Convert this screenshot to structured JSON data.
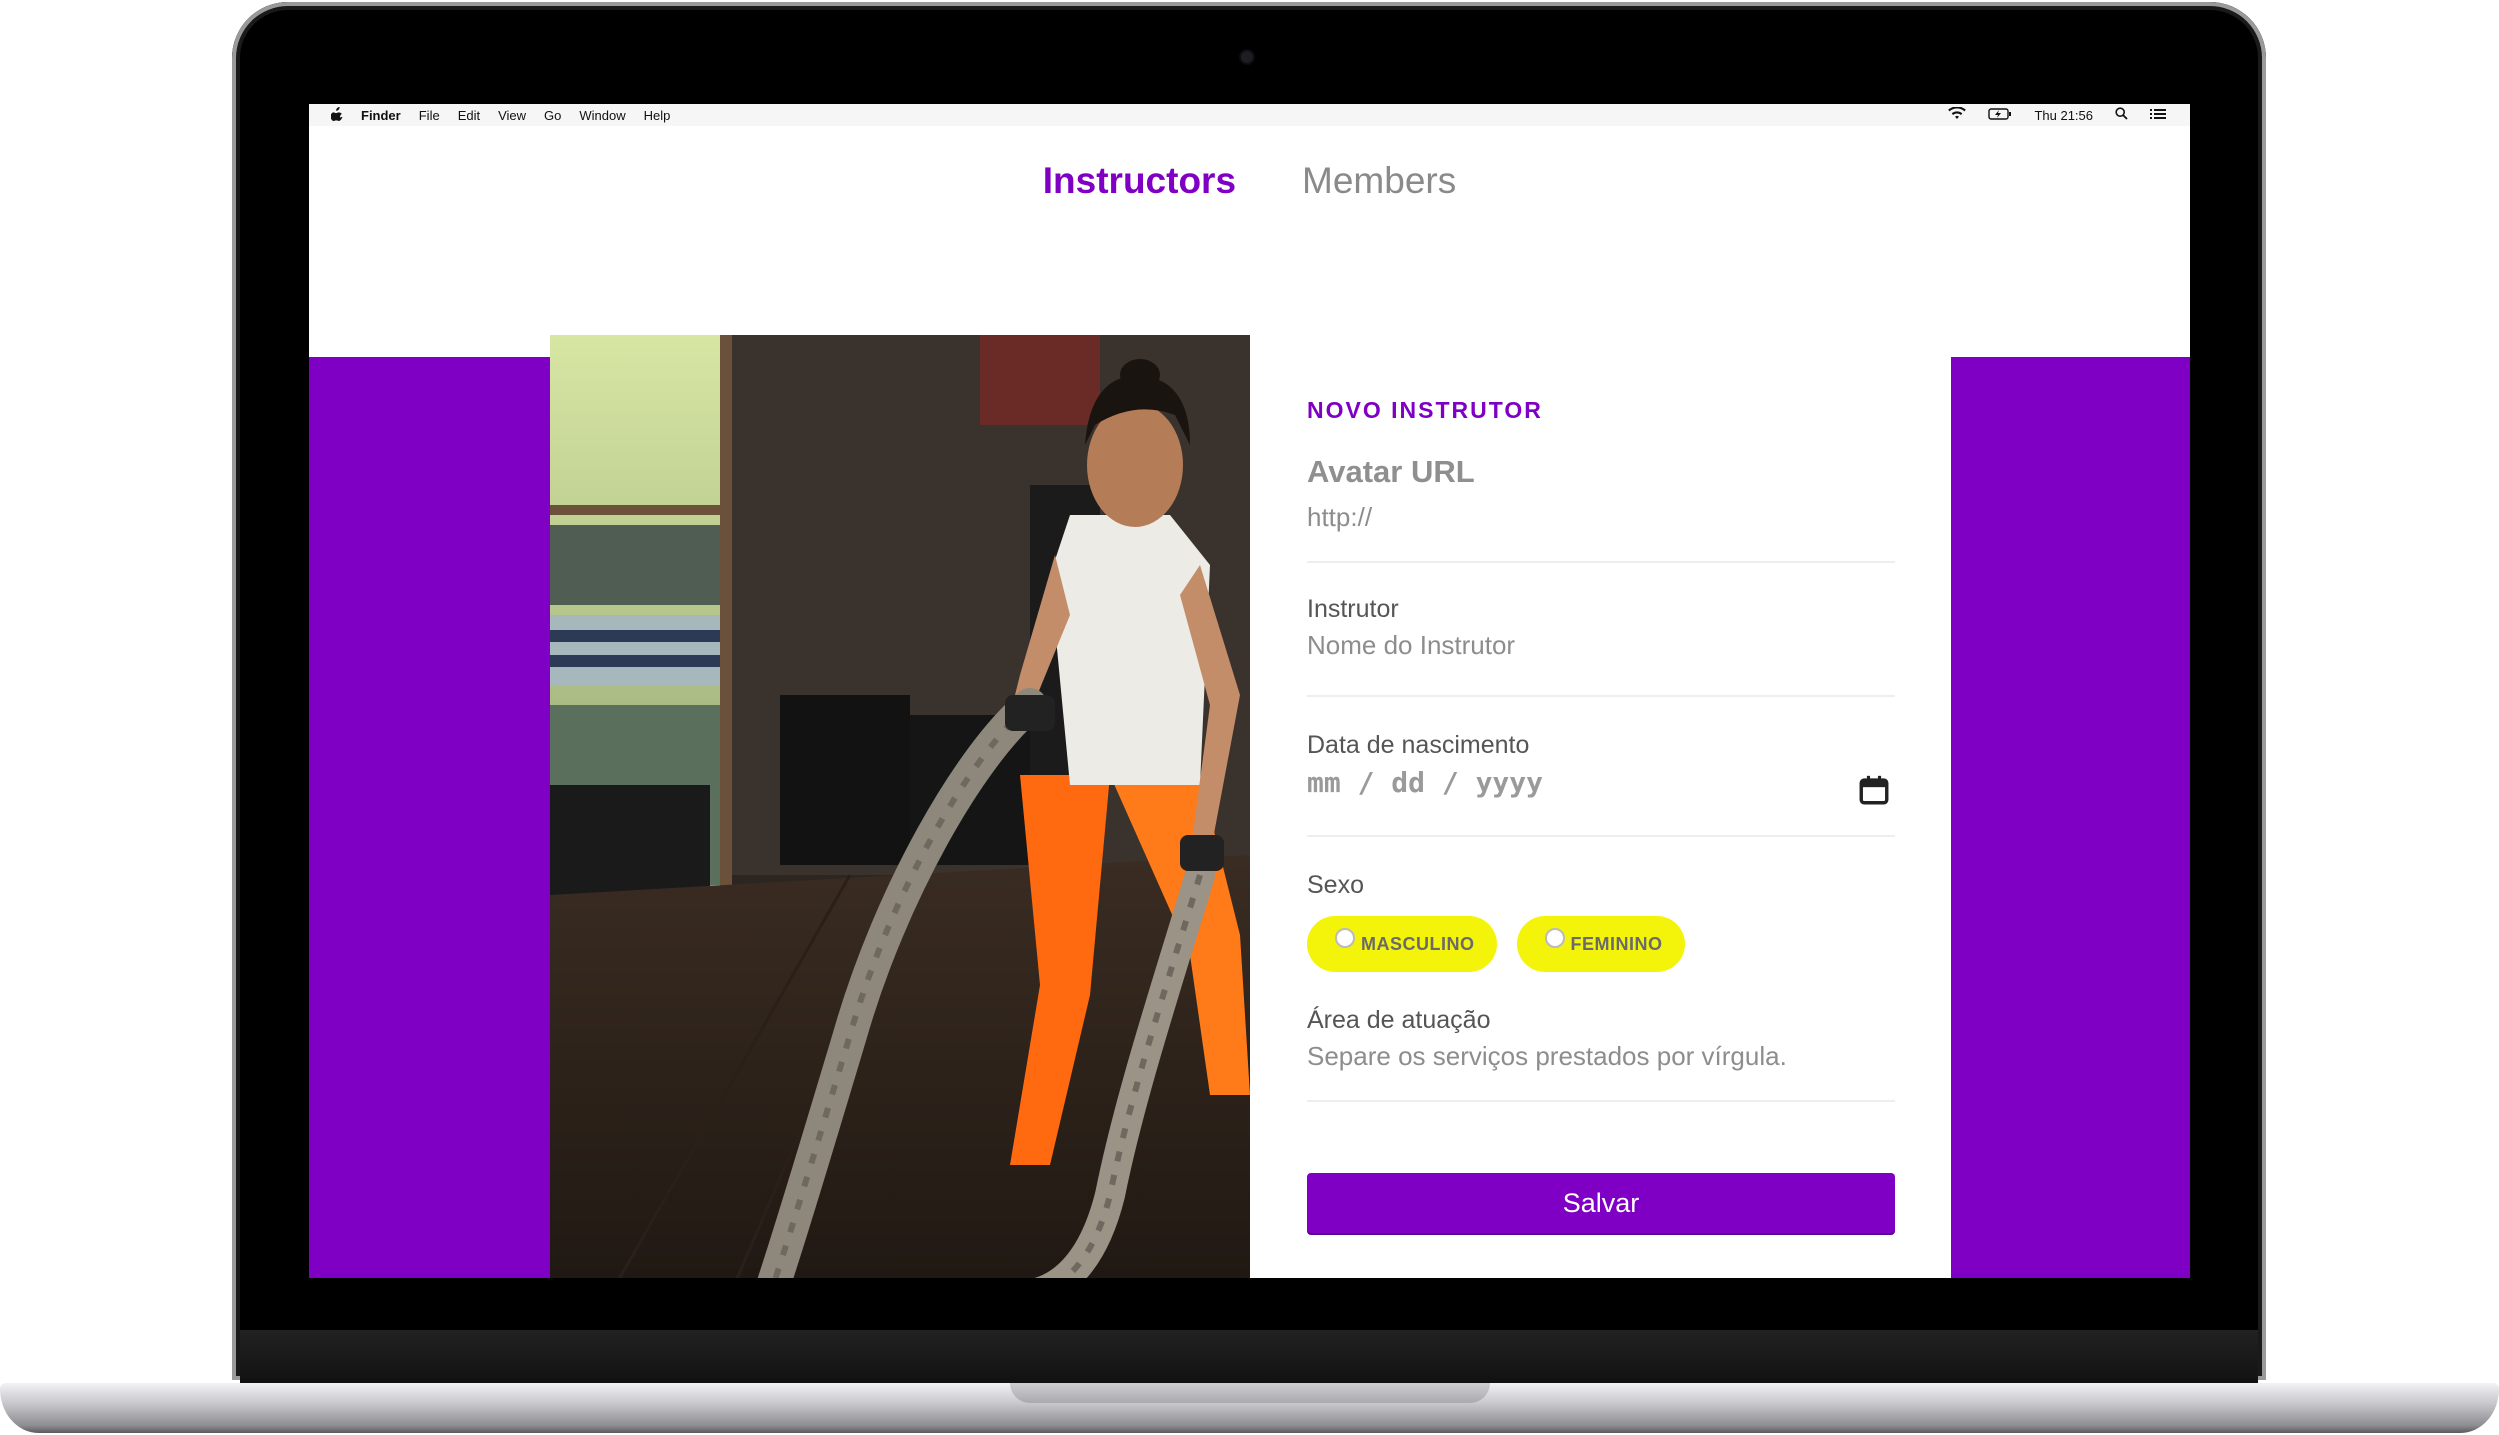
{
  "macos_menubar": {
    "app_name": "Finder",
    "menus": [
      "File",
      "Edit",
      "View",
      "Go",
      "Window",
      "Help"
    ],
    "clock": "Thu 21:56"
  },
  "header": {
    "nav": {
      "instructors": "Instructors",
      "members": "Members"
    }
  },
  "form": {
    "title": "NOVO INSTRUTOR",
    "avatar": {
      "label": "Avatar URL",
      "placeholder": "http://"
    },
    "instrutor": {
      "label": "Instrutor",
      "placeholder": "Nome do Instrutor"
    },
    "nascimento": {
      "label": "Data de nascimento",
      "placeholder": "mm / dd / yyyy"
    },
    "sexo": {
      "label": "Sexo",
      "options": [
        "MASCULINO",
        "FEMININO"
      ]
    },
    "area": {
      "label": "Área de atuação",
      "placeholder": "Separe os serviços prestados por vírgula."
    },
    "save_label": "Salvar"
  },
  "colors": {
    "brand": "#7f00c4",
    "pill": "#f3f40a"
  },
  "icons": [
    "apple-icon",
    "wifi-icon",
    "battery-icon",
    "search-icon",
    "list-icon",
    "calendar-icon"
  ]
}
